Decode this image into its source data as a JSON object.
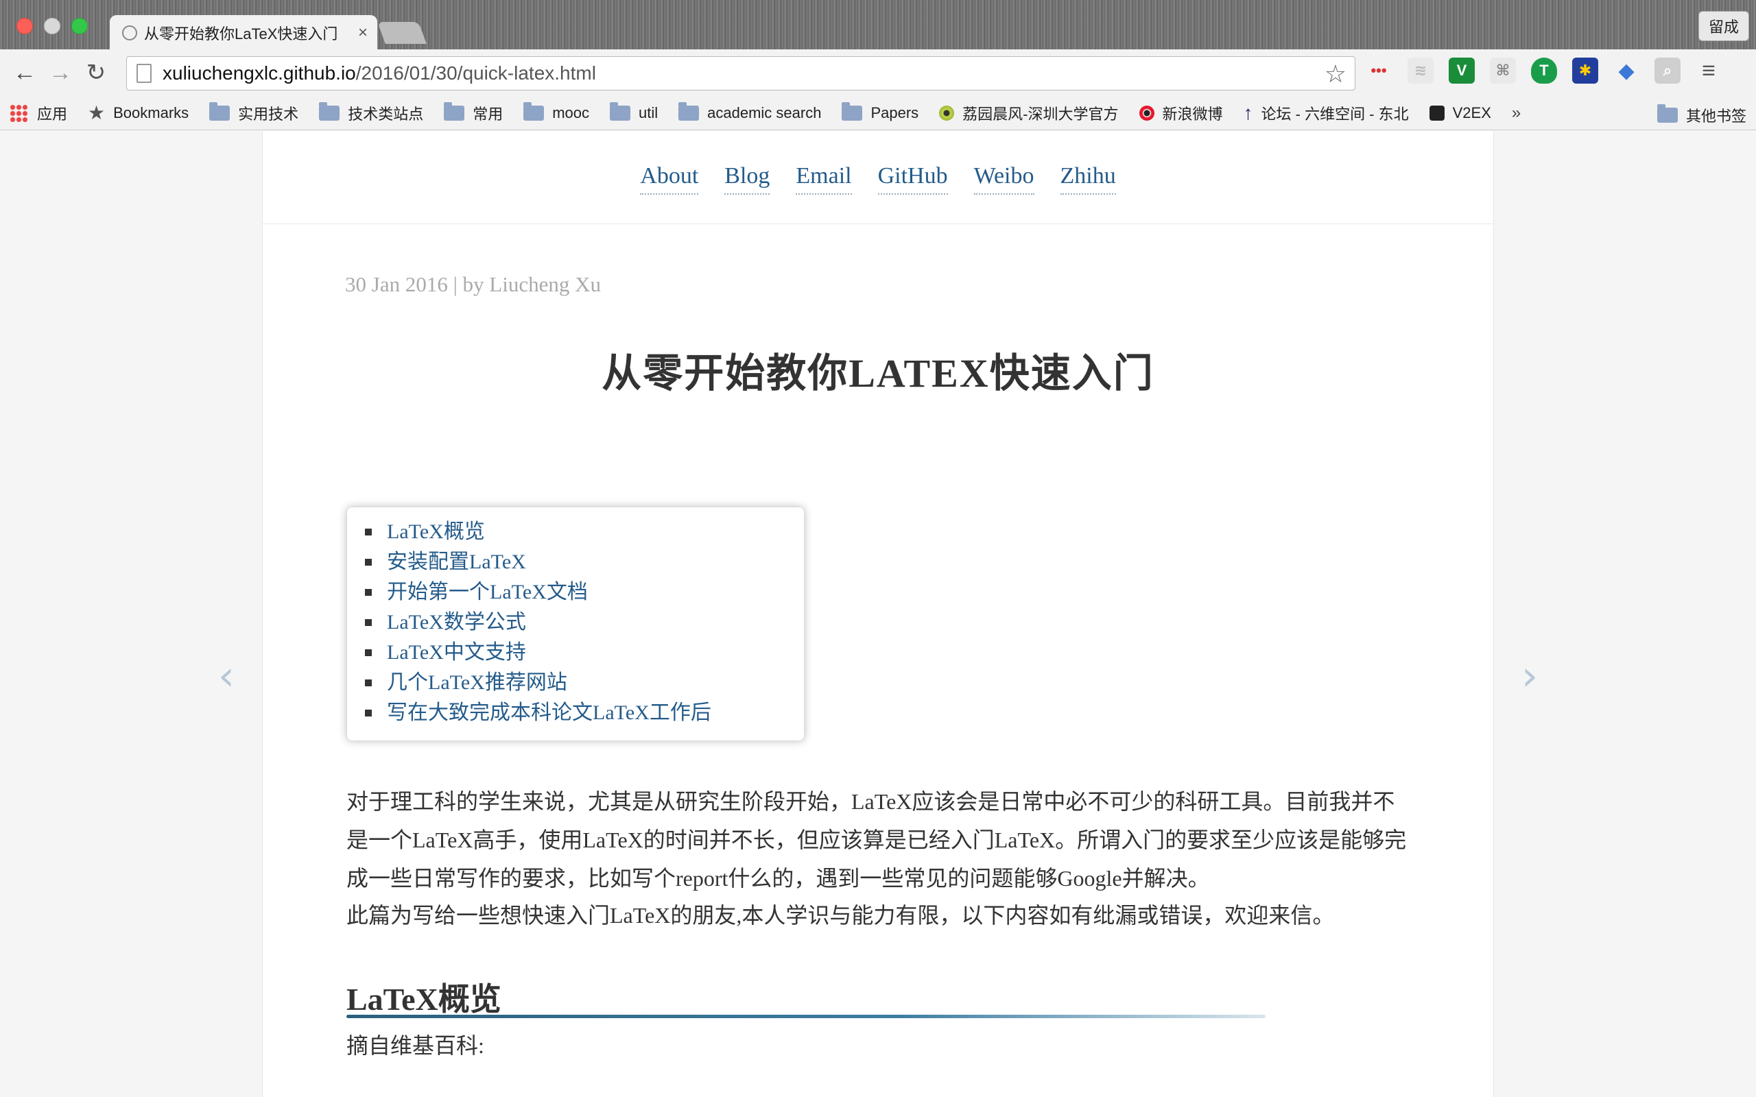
{
  "browser": {
    "tab_title": "从零开始教你LaTeX快速入门",
    "tab_close": "×",
    "profile": "留成",
    "url_host": "xuliuchengxlc.github.io",
    "url_path": "/2016/01/30/quick-latex.html"
  },
  "bookmarks": [
    {
      "label": "应用",
      "icon": "apps-icon"
    },
    {
      "label": "Bookmarks",
      "icon": "star-icon"
    },
    {
      "label": "实用技术",
      "icon": "folder-icon"
    },
    {
      "label": "技术类站点",
      "icon": "folder-icon"
    },
    {
      "label": "常用",
      "icon": "folder-icon"
    },
    {
      "label": "mooc",
      "icon": "folder-icon"
    },
    {
      "label": "util",
      "icon": "folder-icon"
    },
    {
      "label": "academic search",
      "icon": "folder-icon"
    },
    {
      "label": "Papers",
      "icon": "folder-icon"
    },
    {
      "label": "荔园晨风-深圳大学官方",
      "icon": "site-icon"
    },
    {
      "label": "新浪微博",
      "icon": "weibo-icon"
    },
    {
      "label": "论坛 - 六维空间 - 东北",
      "icon": "arrow-icon"
    },
    {
      "label": "V2EX",
      "icon": "v2ex-icon"
    }
  ],
  "bookmarks_more": "»",
  "bookmarks_other": "其他书签",
  "site_nav": [
    "About",
    "Blog",
    "Email",
    "GitHub",
    "Weibo",
    "Zhihu"
  ],
  "post": {
    "meta": "30 Jan 2016 | by Liucheng Xu",
    "title": "从零开始教你LATEX快速入门",
    "toc": [
      "LaTeX概览",
      "安装配置LaTeX",
      "开始第一个LaTeX文档",
      "LaTeX数学公式",
      "LaTeX中文支持",
      "几个LaTeX推荐网站",
      "写在大致完成本科论文LaTeX工作后"
    ],
    "paragraph1": "对于理工科的学生来说，尤其是从研究生阶段开始，LaTeX应该会是日常中必不可少的科研工具。目前我并不是一个LaTeX高手，使用LaTeX的时间并不长，但应该算是已经入门LaTeX。所谓入门的要求至少应该是能够完成一些日常写作的要求，比如写个report什么的，遇到一些常见的问题能够Google并解决。",
    "paragraph2": "此篇为写给一些想快速入门LaTeX的朋友,本人学识与能力有限，以下内容如有纰漏或错误，欢迎来信。",
    "section_heading": "LaTeX概览",
    "paragraph3": "摘自维基百科:"
  },
  "pager": {
    "prev": "‹",
    "next": "›"
  }
}
